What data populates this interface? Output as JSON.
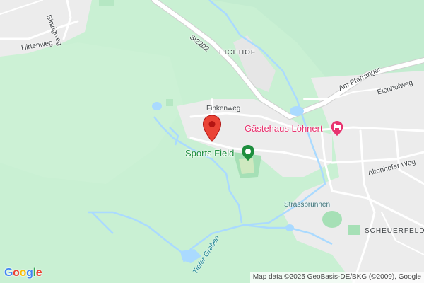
{
  "map": {
    "roads": {
      "binzigweg": "Binzigweg",
      "hirtenweg": "Hirtenweg",
      "st2202": "St2202",
      "am_pfarranger": "Am Pfarranger",
      "eichhofweg": "Eichhofweg",
      "finkenweg": "Finkenweg",
      "altenhofer_weg": "Altenhofer Weg"
    },
    "places": {
      "eichhof": "EICHHOF",
      "scheuerfeld": "SCHEUERFELD"
    },
    "water": {
      "strassbrunnen": "Strassbrunnen",
      "tiefer_graben": "Tiefer Graben"
    },
    "pois": {
      "sports_field": "Sports Field",
      "guesthouse": "Gästehaus Löhnert"
    },
    "marker_icon": "map-pin-icon",
    "colors": {
      "forest": "#c9f0d3",
      "builtup": "#ececec",
      "water": "#aadaff",
      "marker": "#ea4335",
      "poi_green": "#1e8e3e",
      "poi_pink": "#e8336f"
    }
  },
  "footer": {
    "logo": "Google",
    "attribution": "Map data ©2025 GeoBasis-DE/BKG (©2009), Google"
  }
}
